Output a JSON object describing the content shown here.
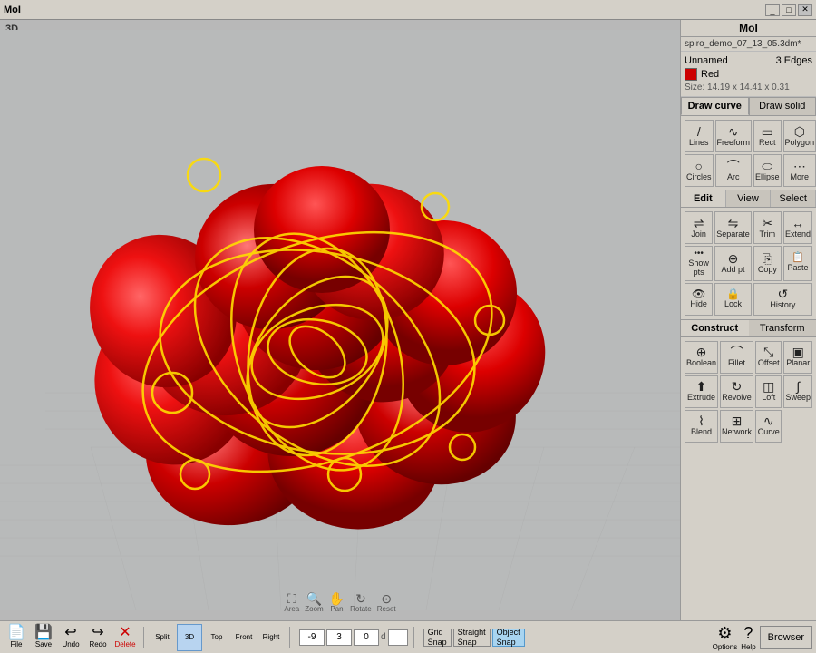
{
  "titleBar": {
    "label": "MoI",
    "minimizeLabel": "_",
    "maximizeLabel": "□",
    "closeLabel": "✕"
  },
  "fileName": "spiro_demo_07_13_05.3dm*",
  "objectInfo": {
    "name": "Unnamed",
    "edges": "3 Edges",
    "colorLabel": "Red",
    "size": "Size: 14.19 x 14.41 x 0.31"
  },
  "drawCurveTab": "Draw curve",
  "drawSolidTab": "Draw solid",
  "drawCurveTools": [
    {
      "label": "Lines",
      "icon": "/"
    },
    {
      "label": "Freeform",
      "icon": "∿"
    },
    {
      "label": "Rect",
      "icon": "▭"
    },
    {
      "label": "Polygon",
      "icon": "⬡"
    },
    {
      "label": "Circles",
      "icon": "○"
    },
    {
      "label": "Arc",
      "icon": "⌒"
    },
    {
      "label": "Ellipse",
      "icon": "⬭"
    },
    {
      "label": "More",
      "icon": "⋯"
    }
  ],
  "editTabs": [
    "Edit",
    "View",
    "Select"
  ],
  "editTools": [
    {
      "label": "Join",
      "icon": "⇌"
    },
    {
      "label": "Separate",
      "icon": "⇋"
    },
    {
      "label": "Trim",
      "icon": "✂"
    },
    {
      "label": "Extend",
      "icon": "↔"
    },
    {
      "label": "Show pts",
      "icon": "·̣"
    },
    {
      "label": "Add pt",
      "icon": "+"
    },
    {
      "label": "Copy",
      "icon": "⎘"
    },
    {
      "label": "Paste",
      "icon": "📋"
    },
    {
      "label": "Hide",
      "icon": "👁"
    },
    {
      "label": "Lock",
      "icon": "🔒"
    },
    {
      "label": "History",
      "icon": "↺"
    }
  ],
  "constructTabs": [
    "Construct",
    "Transform"
  ],
  "constructTools": [
    {
      "label": "Boolean",
      "icon": "⊕"
    },
    {
      "label": "Fillet",
      "icon": "⌒"
    },
    {
      "label": "Offset",
      "icon": "⤡"
    },
    {
      "label": "Planar",
      "icon": "▣"
    },
    {
      "label": "Extrude",
      "icon": "⬆"
    },
    {
      "label": "Revolve",
      "icon": "↻"
    },
    {
      "label": "Loft",
      "icon": "◫"
    },
    {
      "label": "Sweep",
      "icon": "∫"
    },
    {
      "label": "Blend",
      "icon": "⌇"
    },
    {
      "label": "Network",
      "icon": "⊞"
    },
    {
      "label": "Curve",
      "icon": "∿"
    }
  ],
  "viewportLabel": "3D",
  "viewportNav": [
    {
      "label": "Area",
      "icon": "⛶"
    },
    {
      "label": "Zoom",
      "icon": "🔍"
    },
    {
      "label": "Pan",
      "icon": "✋"
    },
    {
      "label": "Rotate",
      "icon": "↻"
    },
    {
      "label": "Reset",
      "icon": "⊙"
    }
  ],
  "bottomTools": [
    {
      "label": "File",
      "icon": "📄"
    },
    {
      "label": "Save",
      "icon": "💾"
    },
    {
      "label": "Undo",
      "icon": "↩"
    },
    {
      "label": "Redo",
      "icon": "↪"
    },
    {
      "label": "Delete",
      "icon": "✕"
    }
  ],
  "viewButtons": [
    "Split",
    "3D",
    "Top",
    "Front",
    "Right"
  ],
  "coords": {
    "x": "-9",
    "y": "3",
    "z": "0",
    "dLabel": "d"
  },
  "snapButtons": [
    {
      "label": "Grid\nSnap",
      "active": false
    },
    {
      "label": "Straight\nSnap",
      "active": false
    },
    {
      "label": "Object\nSnap",
      "active": true
    }
  ],
  "optionsLabel": "Options",
  "helpLabel": "Help",
  "browserLabel": "Browser",
  "accentColor": "#cc0000",
  "activeSnapColor": "#a8d4f0"
}
